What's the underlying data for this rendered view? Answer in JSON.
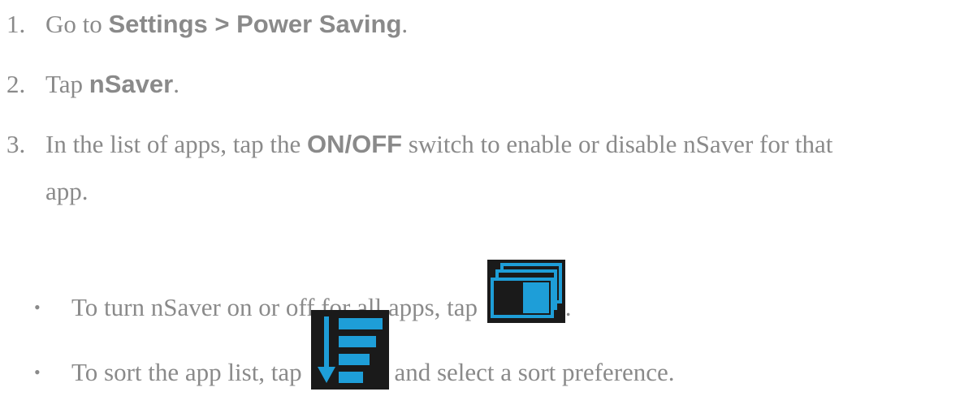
{
  "steps": [
    {
      "number": "1.",
      "text_before": "Go to ",
      "bold": "Settings > Power Saving",
      "text_after": "."
    },
    {
      "number": "2.",
      "text_before": "Tap ",
      "bold": "nSaver",
      "text_after": "."
    },
    {
      "number": "3.",
      "text_before": "In the list of apps, tap the ",
      "bold": "ON/OFF",
      "text_after": " switch to enable or disable nSaver for that",
      "continuation": "app."
    }
  ],
  "bullets": [
    {
      "marker": "•",
      "text_before": "To turn nSaver on or off for all apps, tap ",
      "icon": "toggle-all-icon",
      "text_after": "."
    },
    {
      "marker": "•",
      "text_before": "To sort the app list, tap ",
      "icon": "sort-list-icon",
      "text_after": "and select a sort preference."
    }
  ],
  "colors": {
    "text": "#8a8a8a",
    "icon_background": "#1a1a1a",
    "icon_accent": "#1e9ed8"
  }
}
